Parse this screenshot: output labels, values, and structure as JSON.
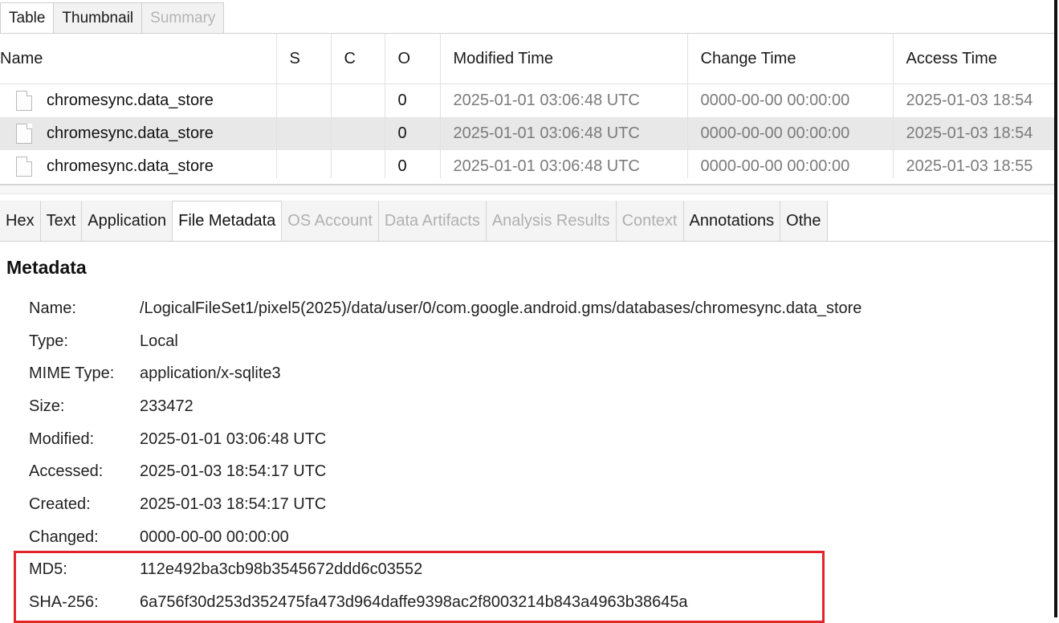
{
  "top_tabs": [
    {
      "label": "Table",
      "state": "active"
    },
    {
      "label": "Thumbnail",
      "state": "normal"
    },
    {
      "label": "Summary",
      "state": "disabled"
    }
  ],
  "table": {
    "columns": [
      "Name",
      "S",
      "C",
      "O",
      "Modified Time",
      "Change Time",
      "Access Time"
    ],
    "rows": [
      {
        "name": "chromesync.data_store",
        "s": "",
        "c": "",
        "o": "0",
        "modified": "2025-01-01 03:06:48 UTC",
        "change": "0000-00-00 00:00:00",
        "access": "2025-01-03 18:54"
      },
      {
        "name": "chromesync.data_store",
        "s": "",
        "c": "",
        "o": "0",
        "modified": "2025-01-01 03:06:48 UTC",
        "change": "0000-00-00 00:00:00",
        "access": "2025-01-03 18:54"
      },
      {
        "name": "chromesync.data_store",
        "s": "",
        "c": "",
        "o": "0",
        "modified": "2025-01-01 03:06:48 UTC",
        "change": "0000-00-00 00:00:00",
        "access": "2025-01-03 18:55"
      }
    ]
  },
  "viewer_tabs": [
    {
      "label": "Hex",
      "state": "normal"
    },
    {
      "label": "Text",
      "state": "normal"
    },
    {
      "label": "Application",
      "state": "normal"
    },
    {
      "label": "File Metadata",
      "state": "active"
    },
    {
      "label": "OS Account",
      "state": "disabled"
    },
    {
      "label": "Data Artifacts",
      "state": "disabled"
    },
    {
      "label": "Analysis Results",
      "state": "disabled"
    },
    {
      "label": "Context",
      "state": "disabled"
    },
    {
      "label": "Annotations",
      "state": "normal"
    },
    {
      "label": "Othe",
      "state": "normal"
    }
  ],
  "metadata": {
    "title": "Metadata",
    "rows": [
      {
        "key": "Name:",
        "value": "/LogicalFileSet1/pixel5(2025)/data/user/0/com.google.android.gms/databases/chromesync.data_store"
      },
      {
        "key": "Type:",
        "value": "Local"
      },
      {
        "key": "MIME Type:",
        "value": "application/x-sqlite3"
      },
      {
        "key": "Size:",
        "value": "233472"
      },
      {
        "key": "Modified:",
        "value": "2025-01-01 03:06:48 UTC"
      },
      {
        "key": "Accessed:",
        "value": "2025-01-03 18:54:17 UTC"
      },
      {
        "key": "Created:",
        "value": "2025-01-03 18:54:17 UTC"
      },
      {
        "key": "Changed:",
        "value": "0000-00-00 00:00:00"
      },
      {
        "key": "MD5:",
        "value": "112e492ba3cb98b3545672ddd6c03552"
      },
      {
        "key": "SHA-256:",
        "value": "6a756f30d253d352475fa473d964daffe9398ac2f8003214b843a4963b38645a"
      }
    ]
  },
  "colors": {
    "highlight_box": "#e3242b",
    "selected_row": "#e8e8e8",
    "disabled_text": "#b0b0b0"
  }
}
